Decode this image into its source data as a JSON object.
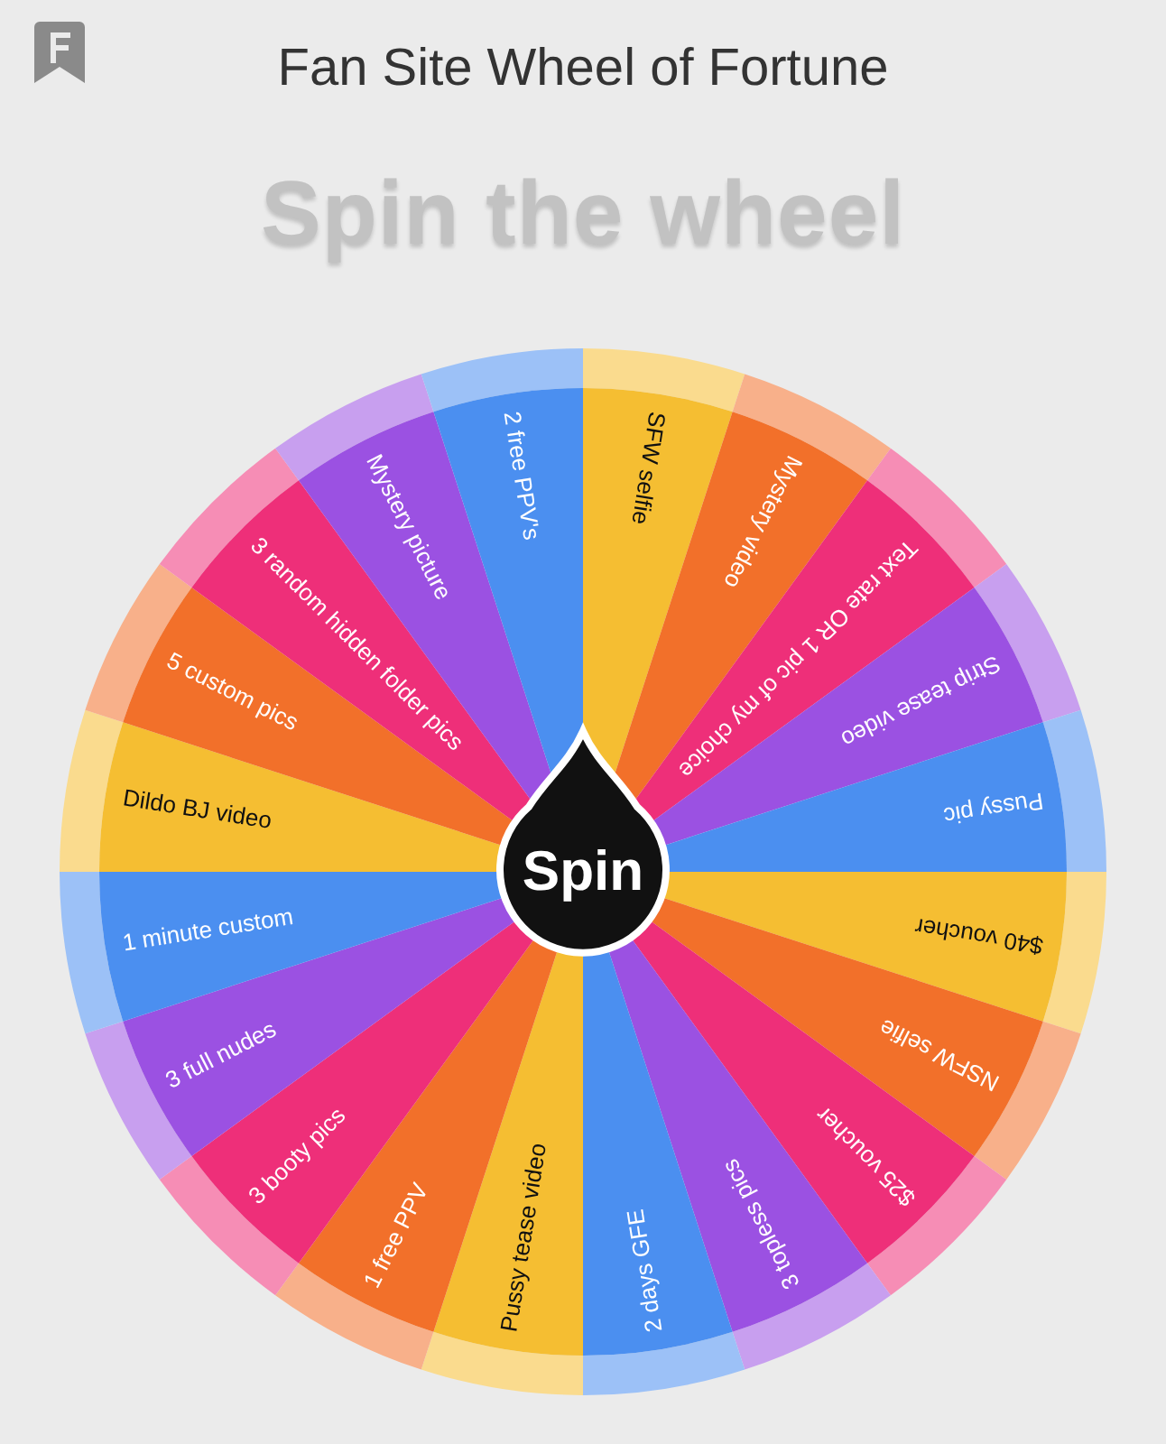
{
  "header": {
    "title": "Fan Site Wheel of Fortune"
  },
  "heading": "Spin the wheel",
  "wheel": {
    "button": "Spin",
    "segments": [
      {
        "label": "SFW selfie",
        "color": "#f5be32"
      },
      {
        "label": "Mystery video",
        "color": "#f2702a"
      },
      {
        "label": "Text rate OR 1 pic of my choice",
        "color": "#ee2f79"
      },
      {
        "label": "Strip tease video",
        "color": "#9b51e2"
      },
      {
        "label": "Pussy pic",
        "color": "#4b8ff0"
      },
      {
        "label": "$40 voucher",
        "color": "#f5be32"
      },
      {
        "label": "NSFW selfie",
        "color": "#f2702a"
      },
      {
        "label": "$25 voucher",
        "color": "#ee2f79"
      },
      {
        "label": "3 topless pics",
        "color": "#9b51e2"
      },
      {
        "label": "2 days GFE",
        "color": "#4b8ff0"
      },
      {
        "label": "Pussy tease video",
        "color": "#f5be32"
      },
      {
        "label": "1 free PPV",
        "color": "#f2702a"
      },
      {
        "label": "3 booty pics",
        "color": "#ee2f79"
      },
      {
        "label": "3 full nudes",
        "color": "#9b51e2"
      },
      {
        "label": "1 minute custom",
        "color": "#4b8ff0"
      },
      {
        "label": "Dildo BJ video",
        "color": "#f5be32"
      },
      {
        "label": "5 custom pics",
        "color": "#f2702a"
      },
      {
        "label": "3 random hidden folder pics",
        "color": "#ee2f79"
      },
      {
        "label": "Mystery picture",
        "color": "#9b51e2"
      },
      {
        "label": "2 free PPV's",
        "color": "#4b8ff0"
      }
    ]
  }
}
